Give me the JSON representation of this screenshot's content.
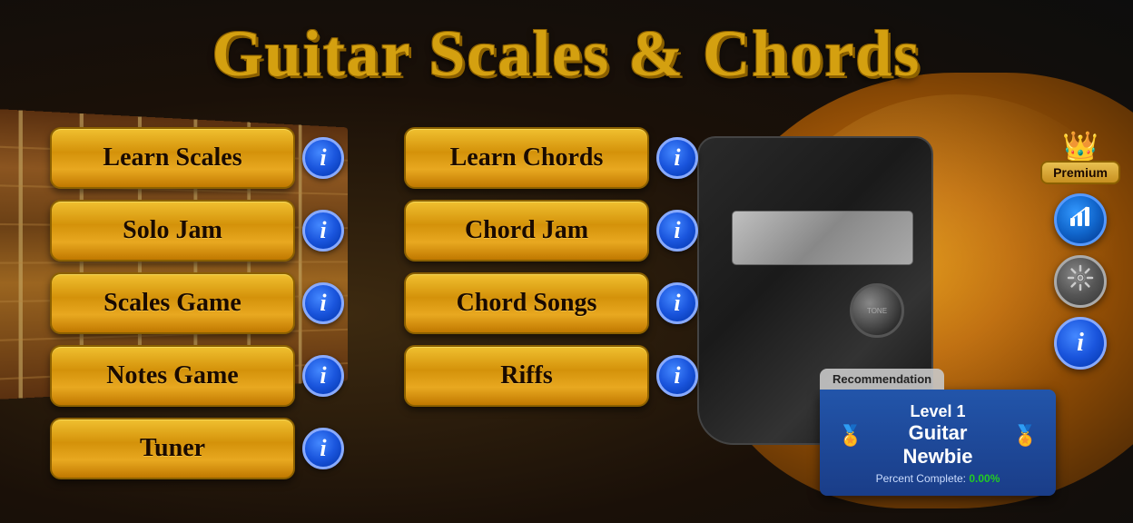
{
  "app": {
    "title": "Guitar Scales & Chords"
  },
  "menu": {
    "left_column": [
      {
        "id": "learn-scales",
        "label": "Learn Scales"
      },
      {
        "id": "solo-jam",
        "label": "Solo Jam"
      },
      {
        "id": "scales-game",
        "label": "Scales Game"
      },
      {
        "id": "notes-game",
        "label": "Notes Game"
      },
      {
        "id": "tuner",
        "label": "Tuner"
      }
    ],
    "right_column": [
      {
        "id": "learn-chords",
        "label": "Learn Chords"
      },
      {
        "id": "chord-jam",
        "label": "Chord Jam"
      },
      {
        "id": "chord-songs",
        "label": "Chord Songs"
      },
      {
        "id": "riffs",
        "label": "Riffs"
      }
    ]
  },
  "right_panel": {
    "premium_label": "Premium",
    "crown": "👑",
    "chart_icon": "📈",
    "gear_icon": "⚙",
    "info_icon": "i"
  },
  "level_card": {
    "recommendation_label": "Recommendation",
    "level_number": "Level 1",
    "level_name": "Guitar Newbie",
    "percent_label": "Percent Complete:",
    "percent_value": "0.00%"
  },
  "info_button_label": "i",
  "colors": {
    "btn_gold": "#d4920a",
    "badge_blue": "#1a55dd",
    "title_gold": "#d4a010"
  }
}
